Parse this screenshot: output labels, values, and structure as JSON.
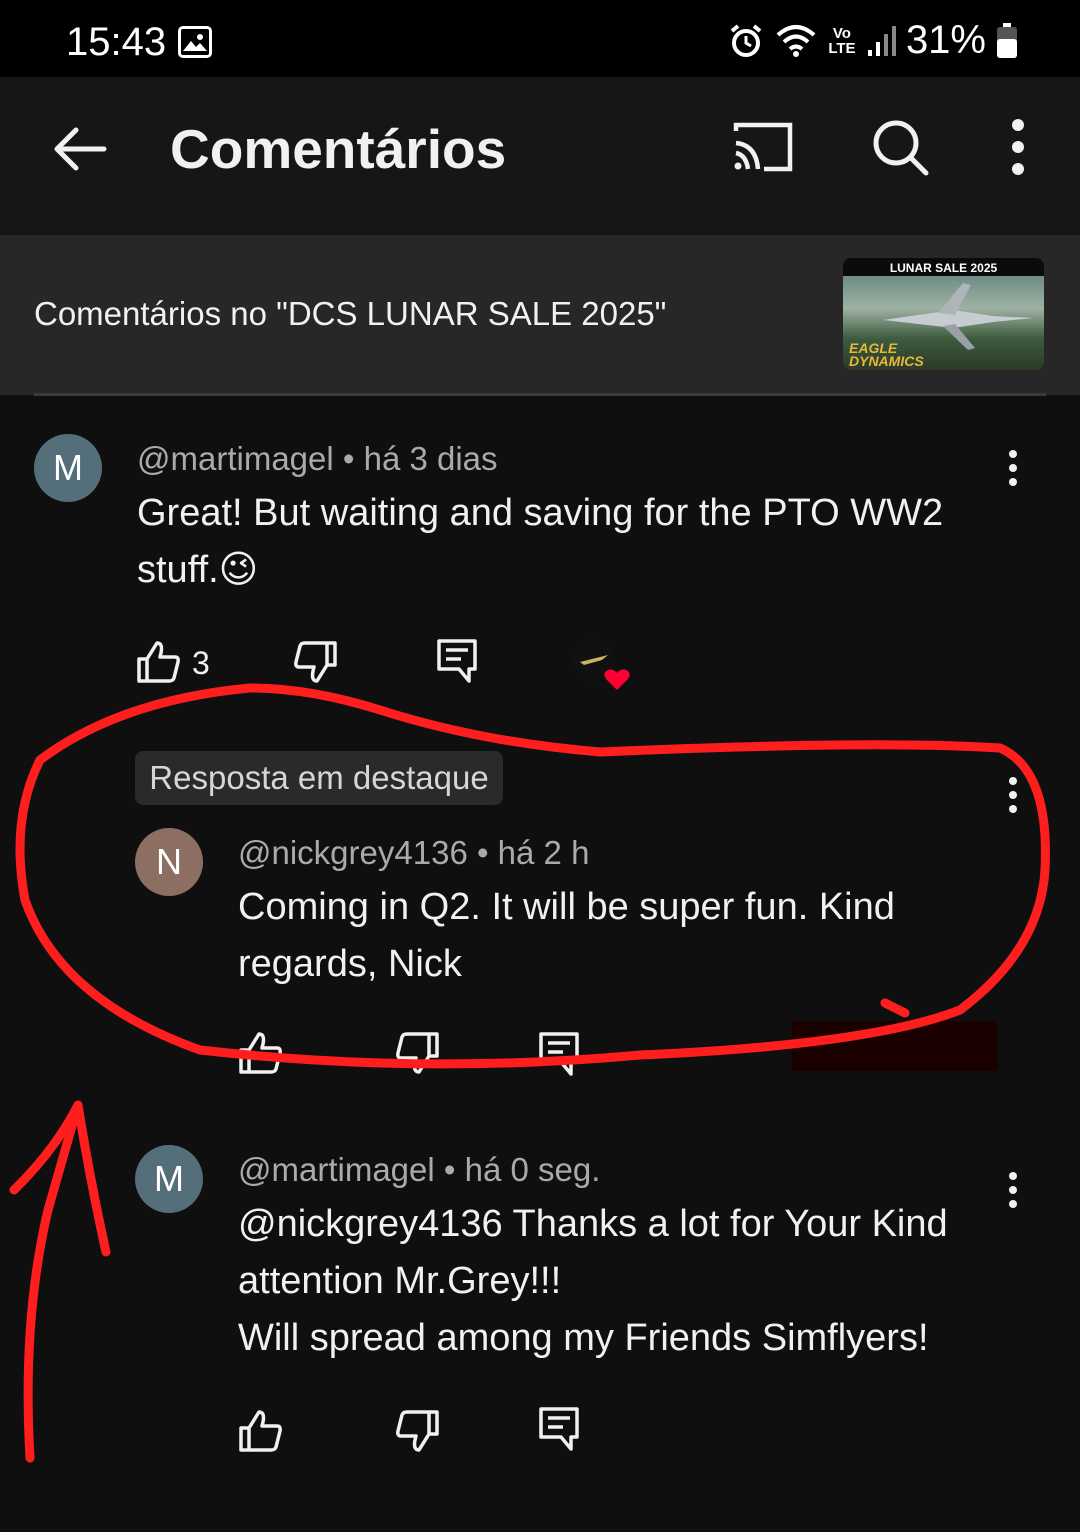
{
  "status_bar": {
    "time": "15:43",
    "network": "Vo LTE",
    "battery": "31%"
  },
  "app_bar": {
    "title": "Comentários"
  },
  "video": {
    "header_text": "Comentários no \"DCS LUNAR SALE 2025\"",
    "thumb_title": "LUNAR SALE 2025",
    "thumb_brand_line1": "EAGLE",
    "thumb_brand_line2": "DYNAMICS"
  },
  "comments": [
    {
      "avatar_letter": "M",
      "meta": "@martimagel • há 3 dias",
      "line1": "Great! But waiting and saving for the PTO WW2",
      "line2": "stuff.😉",
      "likes": "3"
    }
  ],
  "highlight": {
    "badge": "Resposta em destaque"
  },
  "replies": [
    {
      "avatar_letter": "N",
      "meta": "@nickgrey4136 • há 2 h",
      "line1": "Coming in Q2. It will be super fun. Kind",
      "line2": "regards, Nick"
    },
    {
      "avatar_letter": "M",
      "meta": "@martimagel • há 0 seg.",
      "line1": "@nickgrey4136  Thanks a lot for Your Kind",
      "line2": "attention Mr.Grey!!!",
      "line3": "Will spread among my Friends Simflyers!"
    }
  ],
  "colors": {
    "avatar_m": "#546e7a",
    "avatar_n": "#8d6e63",
    "annotation_red": "#ff1e1e"
  },
  "icons": [
    "back-arrow-icon",
    "cast-icon",
    "search-icon",
    "more-vert-icon",
    "thumbs-up-icon",
    "thumbs-down-icon",
    "reply-icon",
    "heart-icon",
    "alarm-icon",
    "wifi-icon",
    "signal-icon",
    "battery-icon",
    "image-icon"
  ]
}
